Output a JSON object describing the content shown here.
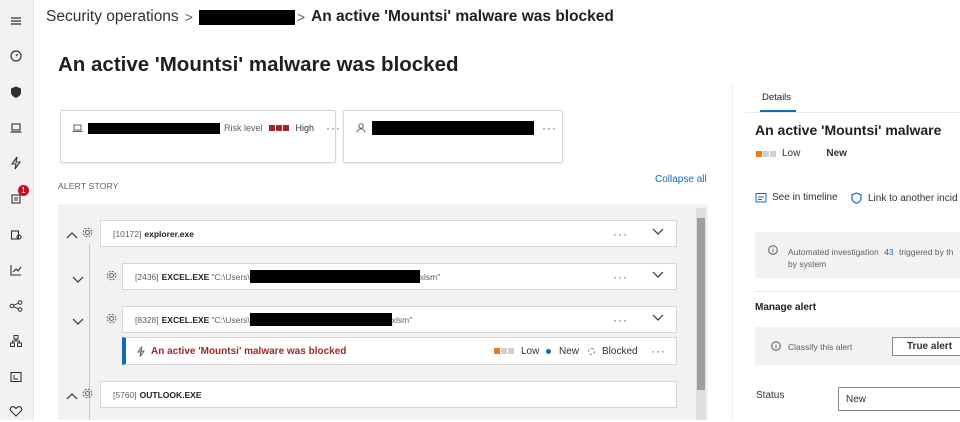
{
  "nav": {
    "items": [
      "menu-icon",
      "dashboard-icon",
      "shield-icon",
      "laptop-icon",
      "bolt-icon",
      "incidents-icon",
      "hunting-icon",
      "chart-icon",
      "graph-icon",
      "network-icon",
      "mailbox-icon",
      "heart-icon"
    ],
    "incidents_badge": "1"
  },
  "breadcrumb": {
    "root": "Security operations",
    "separator": ">",
    "current": "An active 'Mountsi' malware was blocked"
  },
  "page_title": "An active 'Mountsi' malware was blocked",
  "device_card": {
    "risk_label": "Risk level",
    "risk_value": "High",
    "more": "···"
  },
  "user_card": {
    "more": "···"
  },
  "alert_story": {
    "label": "ALERT STORY",
    "collapse_all": "Collapse all",
    "processes": [
      {
        "pid": "[10172]",
        "exe": "explorer.exe",
        "path": ""
      },
      {
        "pid": "[2436]",
        "exe": "EXCEL.EXE",
        "path": "\"C:\\Users\\",
        "suffix": "xlsm\""
      },
      {
        "pid": "[8328]",
        "exe": "EXCEL.EXE",
        "path": "\"C:\\Users\\",
        "suffix": "xlsm\""
      },
      {
        "pid": "[5760]",
        "exe": "OUTLOOK.EXE",
        "path": ""
      }
    ],
    "alert": {
      "title": "An active 'Mountsi' malware was blocked",
      "severity": "Low",
      "status": "New",
      "detection": "Blocked"
    },
    "more": "···"
  },
  "details_panel": {
    "tab": "Details",
    "title": "An active 'Mountsi' malware",
    "severity": "Low",
    "status": "New",
    "see_in_timeline": "See in timeline",
    "link_incident": "Link to another incid",
    "investigation_text_1": "Automated investigation",
    "investigation_id": "43",
    "investigation_text_2": "triggered by th",
    "investigation_text_3": "by system",
    "manage_alert": "Manage alert",
    "classify_text": "Classify this alert",
    "true_alert": "True alert",
    "status_label": "Status",
    "status_value": "New"
  },
  "colors": {
    "accent": "#0f6cbd",
    "high_risk": "#a4262c",
    "low_severity": "#e97c1a",
    "nav_bg": "#f3f2f1"
  }
}
